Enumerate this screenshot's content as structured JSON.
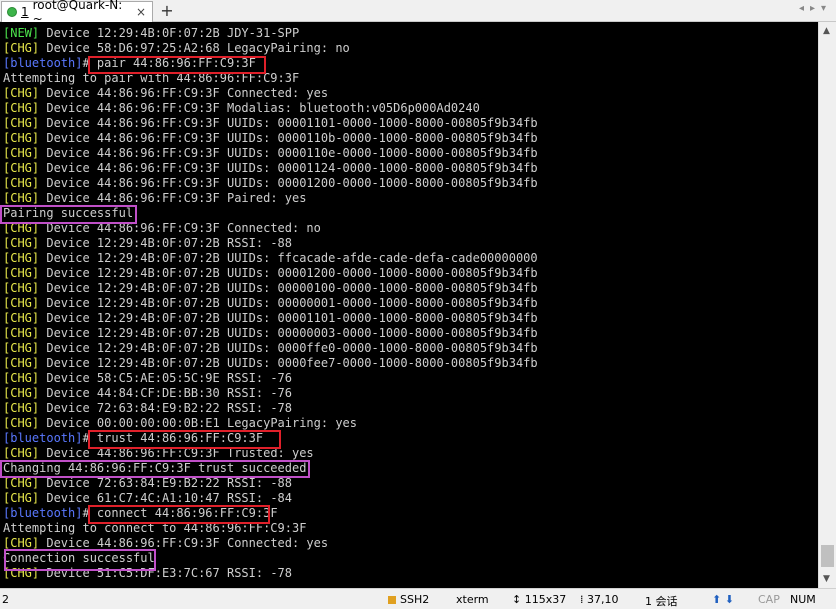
{
  "tabbar": {
    "tab_number": "1",
    "tab_title": "root@Quark-N: ~",
    "close_glyph": "×",
    "new_tab_glyph": "+",
    "nav_glyphs": "◂▸▾"
  },
  "terminal": {
    "lines": [
      [
        [
          "tag-NEW",
          "[NEW]"
        ],
        [
          "",
          "Device 12:29:4B:0F:07:2B JDY-31-SPP"
        ]
      ],
      [
        [
          "tag-CHG",
          "[CHG]"
        ],
        [
          "",
          "Device 58:D6:97:25:A2:68 LegacyPairing: no"
        ]
      ],
      [
        [
          "prompt",
          "[bluetooth]"
        ],
        [
          "",
          "# pair 44:86:96:FF:C9:3F"
        ]
      ],
      [
        [
          "",
          "Attempting to pair with 44:86:96:FF:C9:3F"
        ]
      ],
      [
        [
          "tag-CHG",
          "[CHG]"
        ],
        [
          "",
          "Device 44:86:96:FF:C9:3F Connected: yes"
        ]
      ],
      [
        [
          "tag-CHG",
          "[CHG]"
        ],
        [
          "",
          "Device 44:86:96:FF:C9:3F Modalias: bluetooth:v05D6p000Ad0240"
        ]
      ],
      [
        [
          "tag-CHG",
          "[CHG]"
        ],
        [
          "",
          "Device 44:86:96:FF:C9:3F UUIDs: 00001101-0000-1000-8000-00805f9b34fb"
        ]
      ],
      [
        [
          "tag-CHG",
          "[CHG]"
        ],
        [
          "",
          "Device 44:86:96:FF:C9:3F UUIDs: 0000110b-0000-1000-8000-00805f9b34fb"
        ]
      ],
      [
        [
          "tag-CHG",
          "[CHG]"
        ],
        [
          "",
          "Device 44:86:96:FF:C9:3F UUIDs: 0000110e-0000-1000-8000-00805f9b34fb"
        ]
      ],
      [
        [
          "tag-CHG",
          "[CHG]"
        ],
        [
          "",
          "Device 44:86:96:FF:C9:3F UUIDs: 00001124-0000-1000-8000-00805f9b34fb"
        ]
      ],
      [
        [
          "tag-CHG",
          "[CHG]"
        ],
        [
          "",
          "Device 44:86:96:FF:C9:3F UUIDs: 00001200-0000-1000-8000-00805f9b34fb"
        ]
      ],
      [
        [
          "tag-CHG",
          "[CHG]"
        ],
        [
          "",
          "Device 44:86:96:FF:C9:3F Paired: yes"
        ]
      ],
      [
        [
          "",
          "Pairing successful"
        ]
      ],
      [
        [
          "tag-CHG",
          "[CHG]"
        ],
        [
          "",
          "Device 44:86:96:FF:C9:3F Connected: no"
        ]
      ],
      [
        [
          "tag-CHG",
          "[CHG]"
        ],
        [
          "",
          "Device 12:29:4B:0F:07:2B RSSI: -88"
        ]
      ],
      [
        [
          "tag-CHG",
          "[CHG]"
        ],
        [
          "",
          "Device 12:29:4B:0F:07:2B UUIDs: ffcacade-afde-cade-defa-cade00000000"
        ]
      ],
      [
        [
          "tag-CHG",
          "[CHG]"
        ],
        [
          "",
          "Device 12:29:4B:0F:07:2B UUIDs: 00001200-0000-1000-8000-00805f9b34fb"
        ]
      ],
      [
        [
          "tag-CHG",
          "[CHG]"
        ],
        [
          "",
          "Device 12:29:4B:0F:07:2B UUIDs: 00000100-0000-1000-8000-00805f9b34fb"
        ]
      ],
      [
        [
          "tag-CHG",
          "[CHG]"
        ],
        [
          "",
          "Device 12:29:4B:0F:07:2B UUIDs: 00000001-0000-1000-8000-00805f9b34fb"
        ]
      ],
      [
        [
          "tag-CHG",
          "[CHG]"
        ],
        [
          "",
          "Device 12:29:4B:0F:07:2B UUIDs: 00001101-0000-1000-8000-00805f9b34fb"
        ]
      ],
      [
        [
          "tag-CHG",
          "[CHG]"
        ],
        [
          "",
          "Device 12:29:4B:0F:07:2B UUIDs: 00000003-0000-1000-8000-00805f9b34fb"
        ]
      ],
      [
        [
          "tag-CHG",
          "[CHG]"
        ],
        [
          "",
          "Device 12:29:4B:0F:07:2B UUIDs: 0000ffe0-0000-1000-8000-00805f9b34fb"
        ]
      ],
      [
        [
          "tag-CHG",
          "[CHG]"
        ],
        [
          "",
          "Device 12:29:4B:0F:07:2B UUIDs: 0000fee7-0000-1000-8000-00805f9b34fb"
        ]
      ],
      [
        [
          "tag-CHG",
          "[CHG]"
        ],
        [
          "",
          "Device 58:C5:AE:05:5C:9E RSSI: -76"
        ]
      ],
      [
        [
          "tag-CHG",
          "[CHG]"
        ],
        [
          "",
          "Device 44:84:CF:DE:BB:30 RSSI: -76"
        ]
      ],
      [
        [
          "tag-CHG",
          "[CHG]"
        ],
        [
          "",
          "Device 72:63:84:E9:B2:22 RSSI: -78"
        ]
      ],
      [
        [
          "tag-CHG",
          "[CHG]"
        ],
        [
          "",
          "Device 00:00:00:00:0B:E1 LegacyPairing: yes"
        ]
      ],
      [
        [
          "prompt",
          "[bluetooth]"
        ],
        [
          "",
          "# trust 44:86:96:FF:C9:3F"
        ]
      ],
      [
        [
          "tag-CHG",
          "[CHG]"
        ],
        [
          "",
          "Device 44:86:96:FF:C9:3F Trusted: yes"
        ]
      ],
      [
        [
          "",
          "Changing 44:86:96:FF:C9:3F trust succeeded"
        ]
      ],
      [
        [
          "tag-CHG",
          "[CHG]"
        ],
        [
          "",
          "Device 72:63:84:E9:B2:22 RSSI: -88"
        ]
      ],
      [
        [
          "tag-CHG",
          "[CHG]"
        ],
        [
          "",
          "Device 61:C7:4C:A1:10:47 RSSI: -84"
        ]
      ],
      [
        [
          "prompt",
          "[bluetooth]"
        ],
        [
          "",
          "# connect 44:86:96:FF:C9:3F"
        ]
      ],
      [
        [
          "",
          "Attempting to connect to 44:86:96:FF:C9:3F"
        ]
      ],
      [
        [
          "tag-CHG",
          "[CHG]"
        ],
        [
          "",
          "Device 44:86:96:FF:C9:3F Connected: yes"
        ]
      ],
      [
        [
          "",
          "Connection successful"
        ]
      ],
      [
        [
          "tag-CHG",
          "[CHG]"
        ],
        [
          "",
          "Device 51:C5:DF:E3:7C:67 RSSI: -78"
        ]
      ]
    ]
  },
  "statusbar": {
    "left": "2",
    "protocol": "SSH2",
    "term_type": "xterm",
    "size": "115x37",
    "cursor": "37,10",
    "sessions": "1 会话",
    "arrows": "⬆ ⬇",
    "caps": "CAP",
    "num": "NUM"
  },
  "colors": {
    "new_tag": "#4ce44c",
    "chg_tag": "#e6e64a",
    "prompt": "#5a78ff",
    "highlight_red": "#e0202a",
    "highlight_purple": "#c050c8"
  }
}
